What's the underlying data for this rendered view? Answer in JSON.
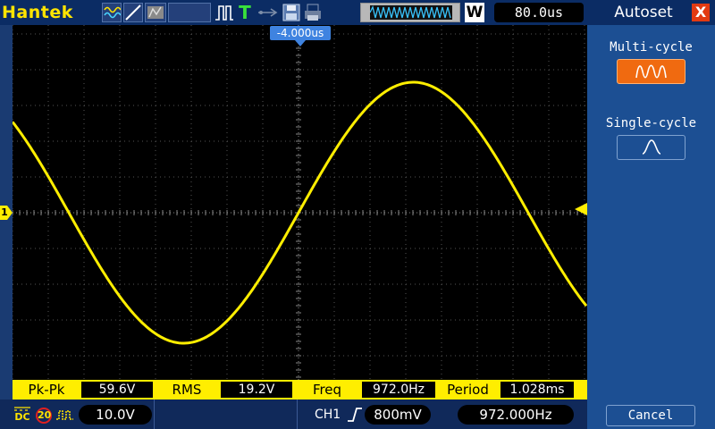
{
  "brand": "Hantek",
  "toolbar": {
    "timebase": "80.0us",
    "w_label": "W",
    "trigger_letter": "T"
  },
  "trigger_position": "-4.000us",
  "channel_marker": "1",
  "panel": {
    "title": "Autoset",
    "close": "X",
    "multi_cycle": "Multi-cycle",
    "single_cycle": "Single-cycle",
    "cancel": "Cancel"
  },
  "measurements": [
    {
      "label": "Pk-Pk",
      "value": "59.6V"
    },
    {
      "label": "RMS",
      "value": "19.2V"
    },
    {
      "label": "Freq",
      "value": "972.0Hz"
    },
    {
      "label": "Period",
      "value": "1.028ms"
    }
  ],
  "bottom": {
    "coupling": "DC",
    "bw_limit": "20",
    "volts_div": "10.0V",
    "trigger_source": "CH1",
    "trigger_level": "800mV",
    "frequency": "972.000Hz"
  },
  "colors": {
    "trace": "#ffee00",
    "accent": "#f06a10",
    "bar": "#ffee00"
  },
  "waveform": {
    "frequency_hz": 972.0,
    "pk_pk_v": 59.6,
    "volts_per_div": 10.0
  }
}
